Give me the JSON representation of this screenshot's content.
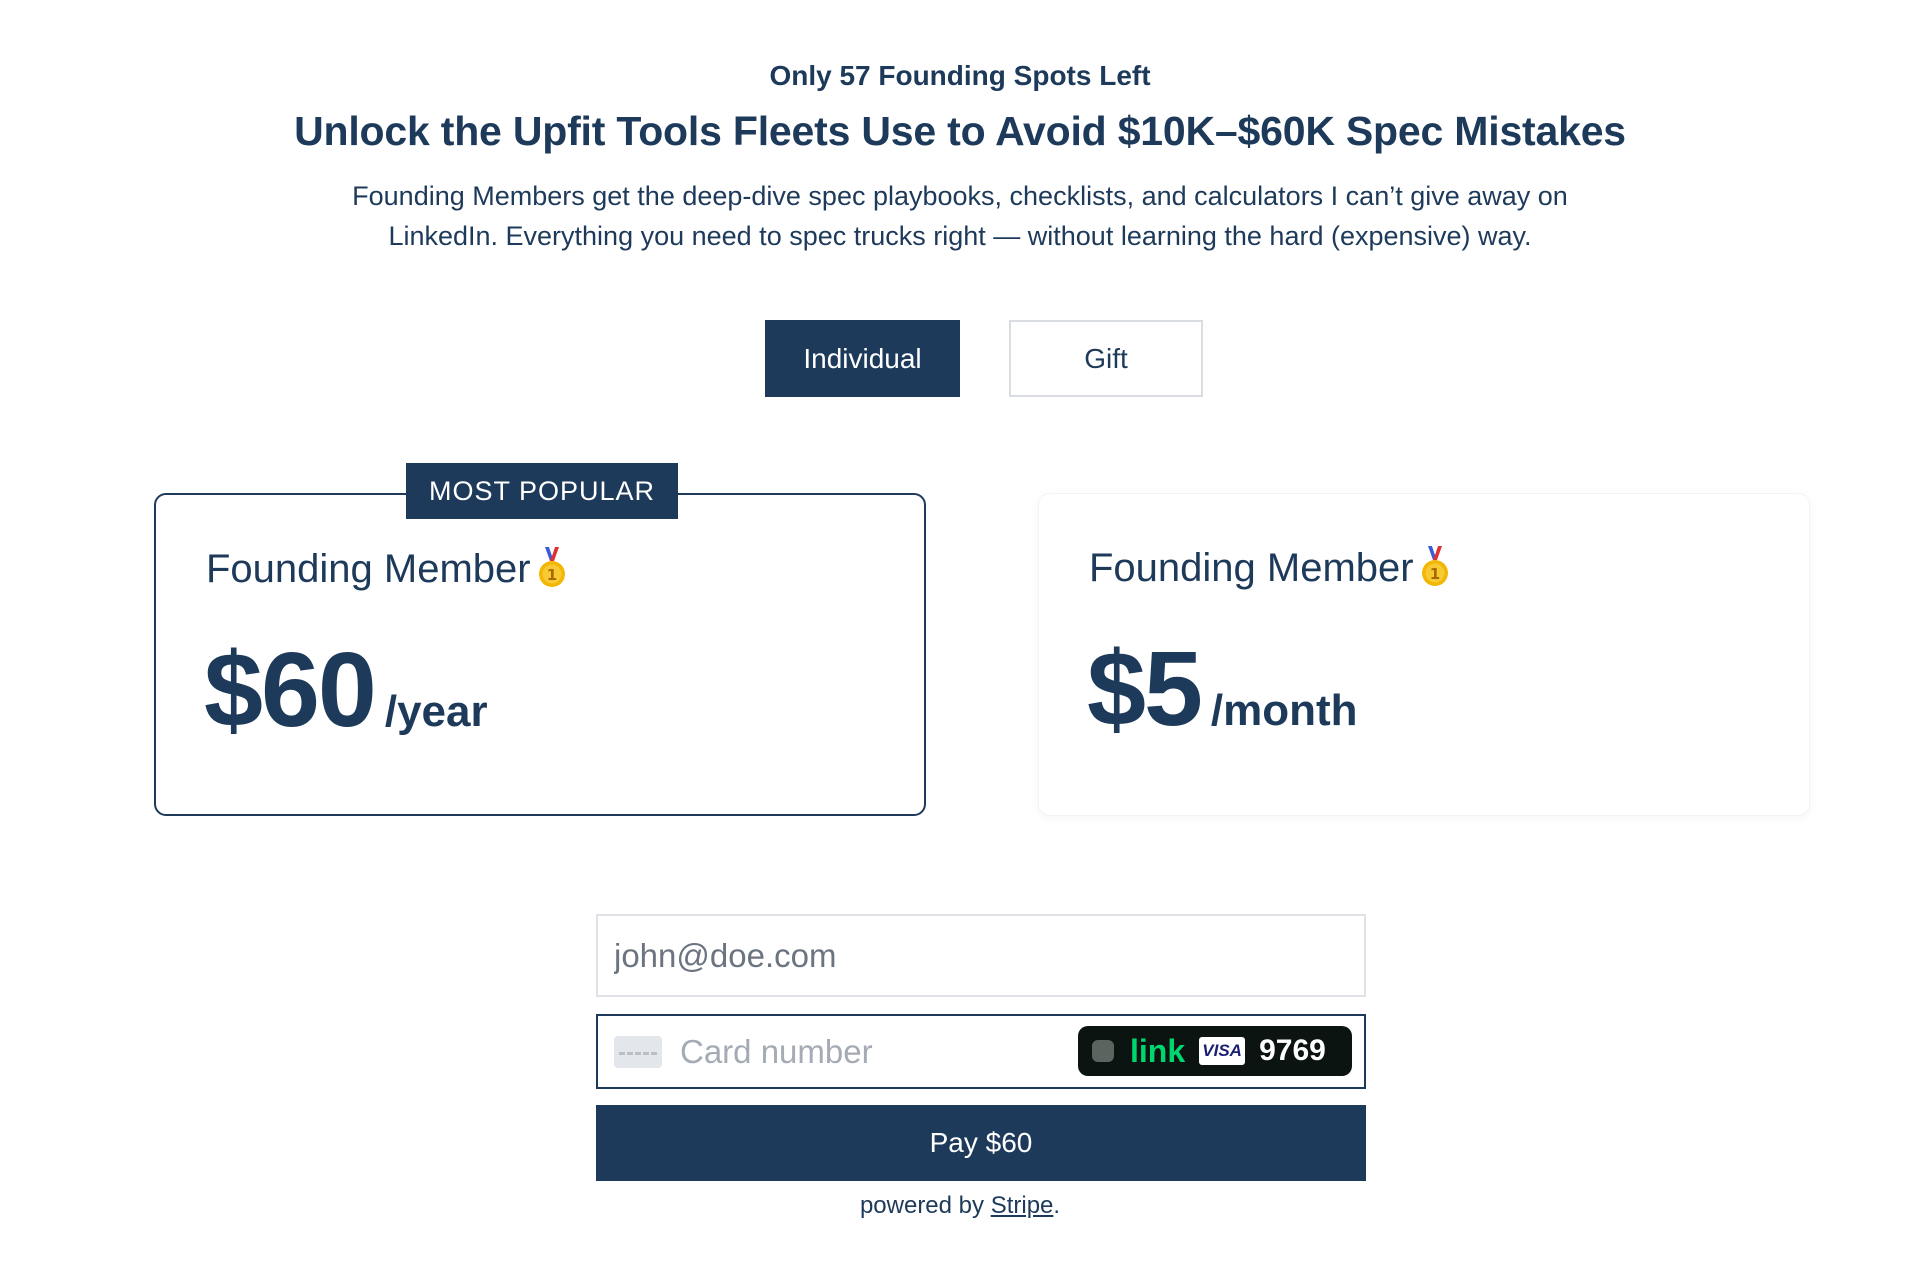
{
  "header": {
    "eyebrow": "Only 57 Founding Spots Left",
    "headline": "Unlock the Upfit Tools Fleets Use to Avoid $10K–$60K Spec Mistakes",
    "subtext": "Founding Members get the deep-dive spec playbooks, checklists, and calculators I can’t give away on LinkedIn. Everything you need to spec trucks right — without learning the hard (expensive) way."
  },
  "toggle": {
    "options": [
      {
        "label": "Individual",
        "selected": true
      },
      {
        "label": "Gift",
        "selected": false
      }
    ]
  },
  "plans": [
    {
      "badge": "MOST POPULAR",
      "name": "Founding Member",
      "icon": "first-place-medal-icon",
      "price": "$60",
      "period": "/year",
      "selected": true
    },
    {
      "name": "Founding Member",
      "icon": "first-place-medal-icon",
      "price": "$5",
      "period": "/month",
      "selected": false
    }
  ],
  "checkout": {
    "email_placeholder": "john@doe.com",
    "card_placeholder": "Card number",
    "link_label": "link",
    "card_brand": "VISA",
    "card_last4": "9769",
    "pay_label": "Pay $60",
    "powered_prefix": "powered by ",
    "powered_link": "Stripe",
    "powered_suffix": "."
  },
  "colors": {
    "brand": "#1e3a5a",
    "link_green": "#00d66f",
    "border": "#dfe3e8"
  }
}
